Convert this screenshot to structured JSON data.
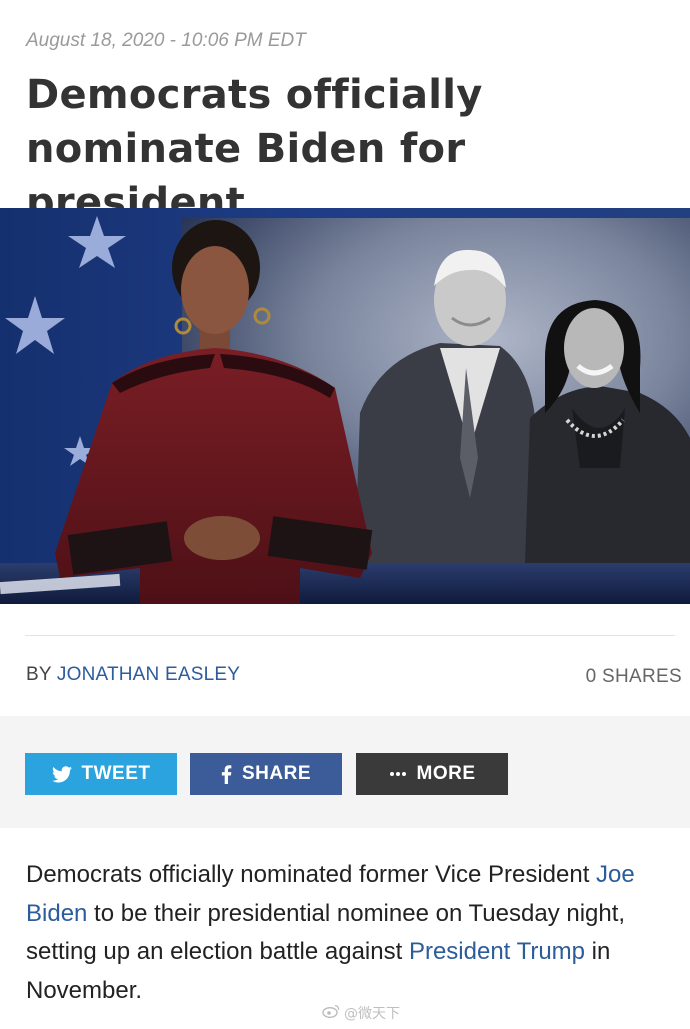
{
  "article": {
    "timestamp": "August 18, 2020 - 10:06 PM EDT",
    "headline": "Democrats officially nominate Biden for president",
    "byline_prefix": "BY",
    "author": "JONATHAN EASLEY",
    "shares": "0  SHARES",
    "body": {
      "t1": "Democrats officially nominated former Vice President ",
      "link1": "Joe Biden",
      "t2": " to be their presidential nominee on Tuesday night, setting up an election battle against ",
      "link2": "President Trump",
      "t3": " in November."
    }
  },
  "share_buttons": {
    "tweet": "TWEET",
    "share": "SHARE",
    "more": "MORE"
  },
  "watermark": "@微天下",
  "colors": {
    "tweet": "#2aa3df",
    "share": "#3b5b99",
    "more": "#3a3a3a",
    "link": "#2c5c9c"
  }
}
